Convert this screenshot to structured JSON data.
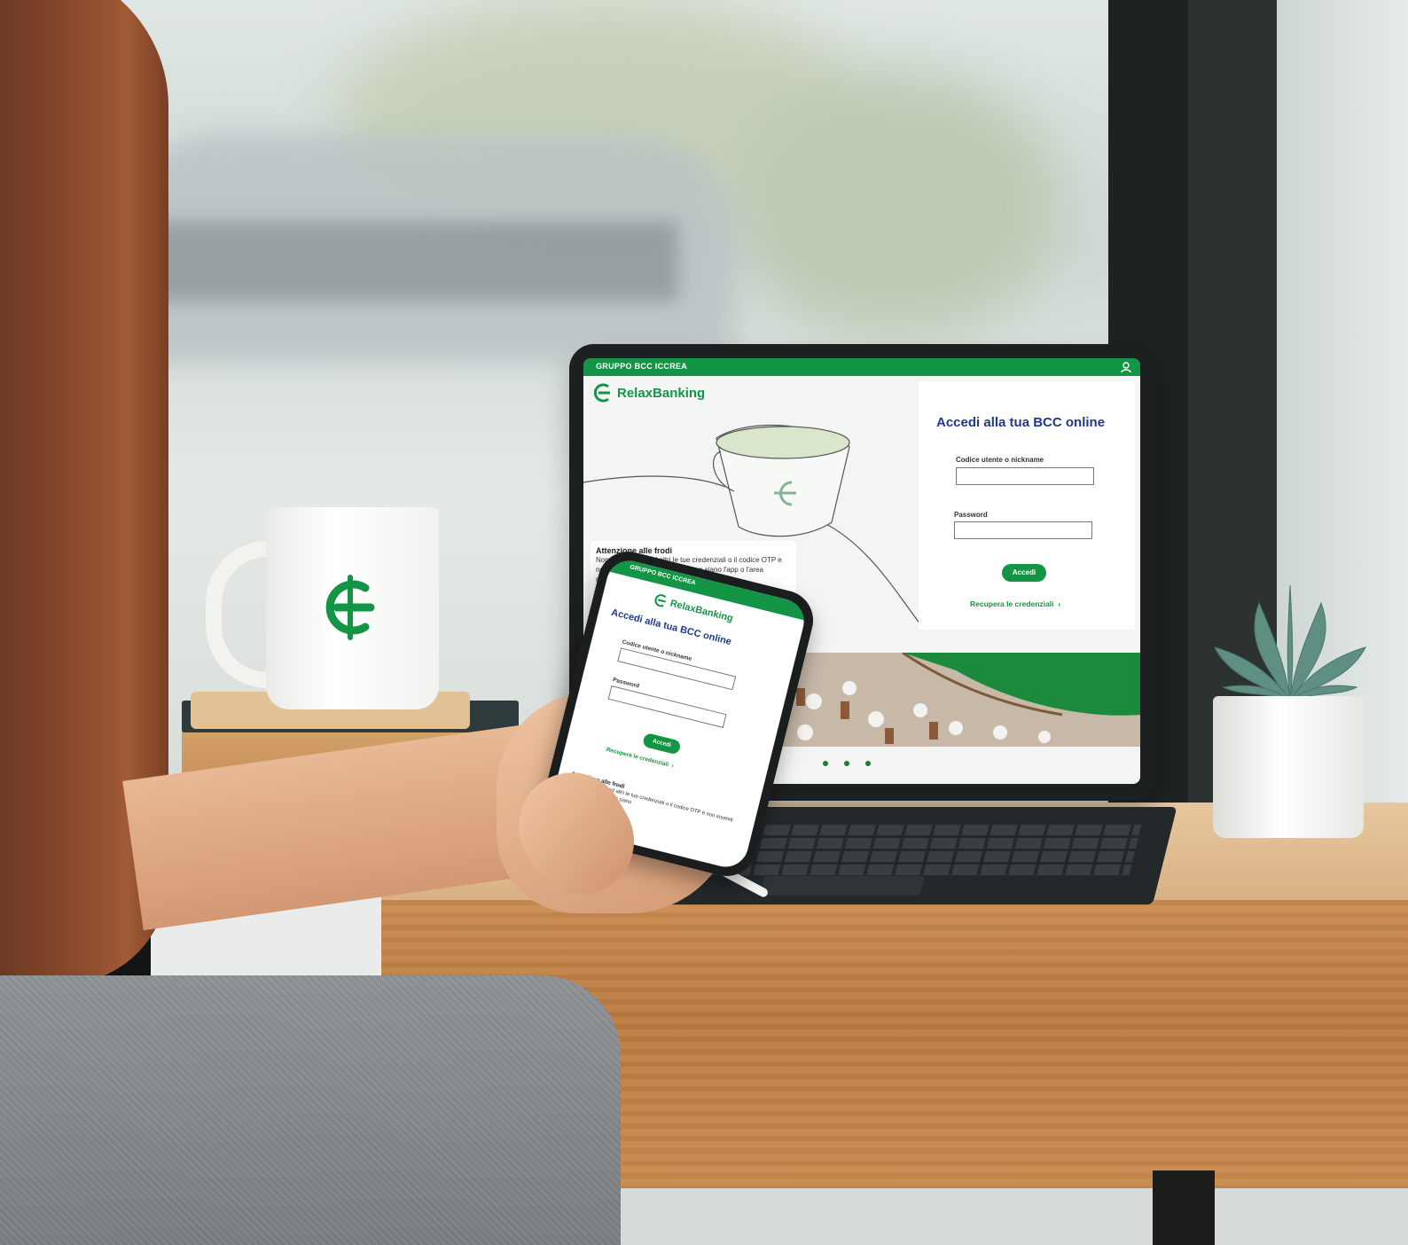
{
  "tablet": {
    "topbar_label": "GRUPPO BCC ICCREA",
    "brand": "RelaxBanking",
    "login_title": "Accedi alla tua BCC online",
    "username_label": "Codice utente o nickname",
    "password_label": "Password",
    "login_button": "Accedi",
    "recover_link": "Recupera le credenziali",
    "fraud_title": "Attenzione alle frodi",
    "fraud_text": "Non comunicare ad altri le tue credenziali o il codice OTP e non inserirli mai su canali che non siano l'app o l'area riservata. Scopri di più",
    "fraud_link": "stopfrodi"
  },
  "phone": {
    "topbar_label": "GRUPPO BCC ICCREA",
    "brand": "RelaxBanking",
    "login_title": "Accedi alla tua BCC online",
    "username_label": "Codice utente o nickname",
    "password_label": "Password",
    "login_button": "Accedi",
    "recover_link": "Recupera le credenziali",
    "fraud_title": "Attenzione alle frodi",
    "fraud_text": "Non comunicare ad altri le tue credenziali o il codice OTP e non inserirli mai su canali che non siano"
  },
  "colors": {
    "brand_green": "#149545",
    "title_blue": "#1f3a8a"
  },
  "icons": {
    "topbar": "user-icon",
    "brand": "bcc-logo-icon",
    "mug": "bcc-logo-icon"
  },
  "carousel": {
    "slides": 3
  }
}
